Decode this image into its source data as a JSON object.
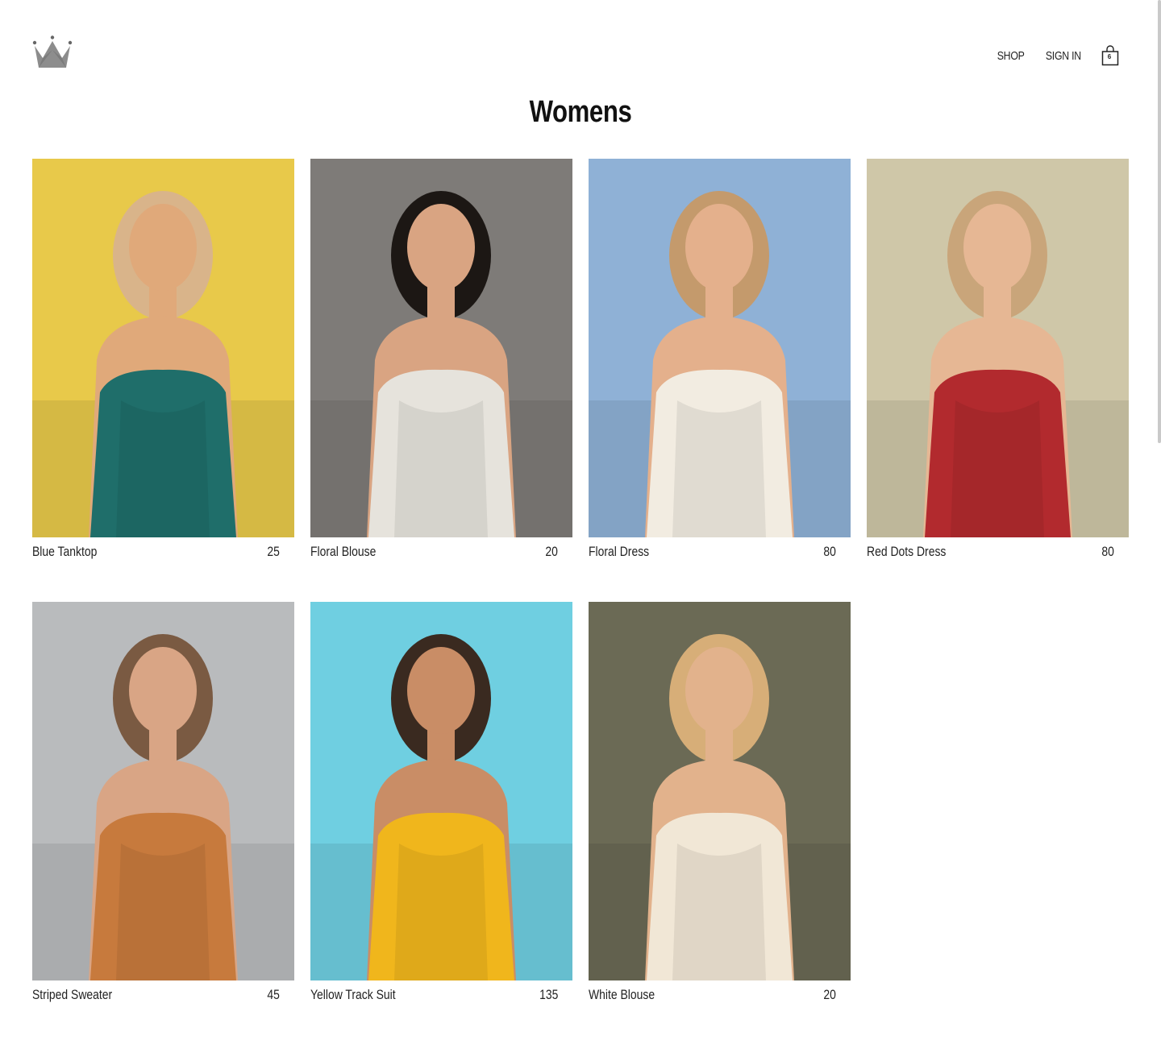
{
  "nav": {
    "shop_label": "SHOP",
    "signin_label": "SIGN IN",
    "cart_count": "6"
  },
  "page_title": "Womens",
  "products": [
    {
      "name": "Blue Tanktop",
      "price": "25",
      "image": "woman-blue-tanktop",
      "bg": "#e8c94a",
      "garment": "#1f6e6a",
      "skin": "#e0a97a",
      "hair": "#d9b48a"
    },
    {
      "name": "Floral Blouse",
      "price": "20",
      "image": "woman-floral-blouse",
      "bg": "#7e7b78",
      "garment": "#e6e3dc",
      "skin": "#d9a482",
      "hair": "#1c1714"
    },
    {
      "name": "Floral Dress",
      "price": "80",
      "image": "woman-floral-dress",
      "bg": "#8fb1d6",
      "garment": "#f2ece1",
      "skin": "#e4b08c",
      "hair": "#c49a6c"
    },
    {
      "name": "Red Dots Dress",
      "price": "80",
      "image": "woman-red-dots-dress",
      "bg": "#cfc7a8",
      "garment": "#b22a2e",
      "skin": "#e6b794",
      "hair": "#c9a57a"
    },
    {
      "name": "Striped Sweater",
      "price": "45",
      "image": "woman-striped-sweater",
      "bg": "#b9bbbd",
      "garment": "#c77a3d",
      "skin": "#d9a585",
      "hair": "#7a5a42"
    },
    {
      "name": "Yellow Track Suit",
      "price": "135",
      "image": "woman-yellow-track-suit",
      "bg": "#6fcfe1",
      "garment": "#f0b61c",
      "skin": "#c98d66",
      "hair": "#3a2a20"
    },
    {
      "name": "White Blouse",
      "price": "20",
      "image": "woman-white-blouse",
      "bg": "#6b6a55",
      "garment": "#f1e7d6",
      "skin": "#e2b28c",
      "hair": "#d7ae78"
    }
  ]
}
